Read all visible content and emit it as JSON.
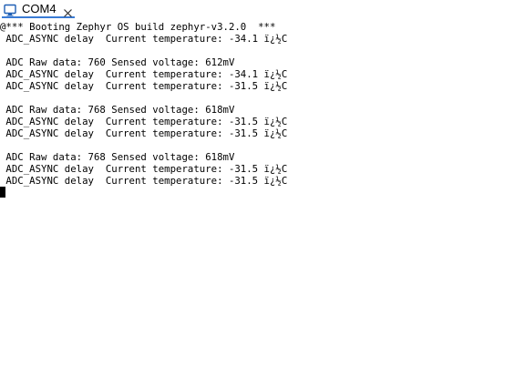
{
  "tab": {
    "label": "COM4",
    "icon": "serial-port-icon",
    "close_icon": "close-icon"
  },
  "terminal": {
    "lines": [
      "@*** Booting Zephyr OS build zephyr-v3.2.0  ***",
      " ADC_ASYNC delay  Current temperature: -34.1 ï¿½C",
      "",
      " ADC Raw data: 760 Sensed voltage: 612mV",
      " ADC_ASYNC delay  Current temperature: -34.1 ï¿½C",
      " ADC_ASYNC delay  Current temperature: -31.5 ï¿½C",
      "",
      " ADC Raw data: 768 Sensed voltage: 618mV",
      " ADC_ASYNC delay  Current temperature: -31.5 ï¿½C",
      " ADC_ASYNC delay  Current temperature: -31.5 ï¿½C",
      "",
      " ADC Raw data: 768 Sensed voltage: 618mV",
      " ADC_ASYNC delay  Current temperature: -31.5 ï¿½C",
      " ADC_ASYNC delay  Current temperature: -31.5 ï¿½C"
    ]
  },
  "colors": {
    "tab_underline": "#3a7bd5",
    "text": "#000000",
    "background": "#ffffff"
  }
}
